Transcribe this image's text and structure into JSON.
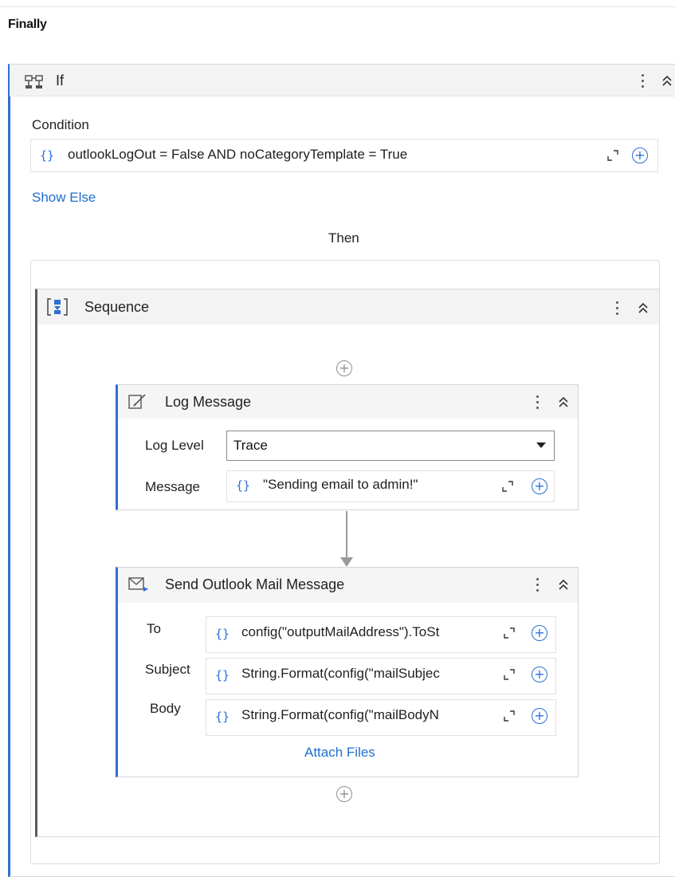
{
  "section": {
    "title": "Finally"
  },
  "if_activity": {
    "title": "If",
    "condition_label": "Condition",
    "condition_value": "outlookLogOut = False AND noCategoryTemplate = True",
    "show_else": "Show Else",
    "then_label": "Then"
  },
  "sequence": {
    "title": "Sequence"
  },
  "log_message": {
    "title": "Log Message",
    "log_level_label": "Log Level",
    "log_level_value": "Trace",
    "message_label": "Message",
    "message_value": "\"Sending email to admin!\""
  },
  "send_mail": {
    "title": "Send Outlook Mail Message",
    "to_label": "To",
    "to_value": "config(\"outputMailAddress\").ToSt",
    "subject_label": "Subject",
    "subject_value": "String.Format(config(\"mailSubjec",
    "body_label": "Body",
    "body_value": "String.Format(config(\"mailBodyN",
    "attach_files": "Attach Files"
  },
  "icons": {
    "if": "if-balance-icon",
    "sequence": "sequence-icon",
    "log_message": "log-message-icon",
    "send_mail": "mail-icon",
    "expression": "braces-icon",
    "expand": "expand-icon",
    "add": "plus-circle-icon",
    "collapse": "chevron-double-up-icon",
    "menu": "kebab-icon",
    "dropdown": "caret-down-icon"
  },
  "colors": {
    "accent": "#2f6fd1",
    "link": "#1f6fd0",
    "sequence_border": "#5a5a5a"
  }
}
